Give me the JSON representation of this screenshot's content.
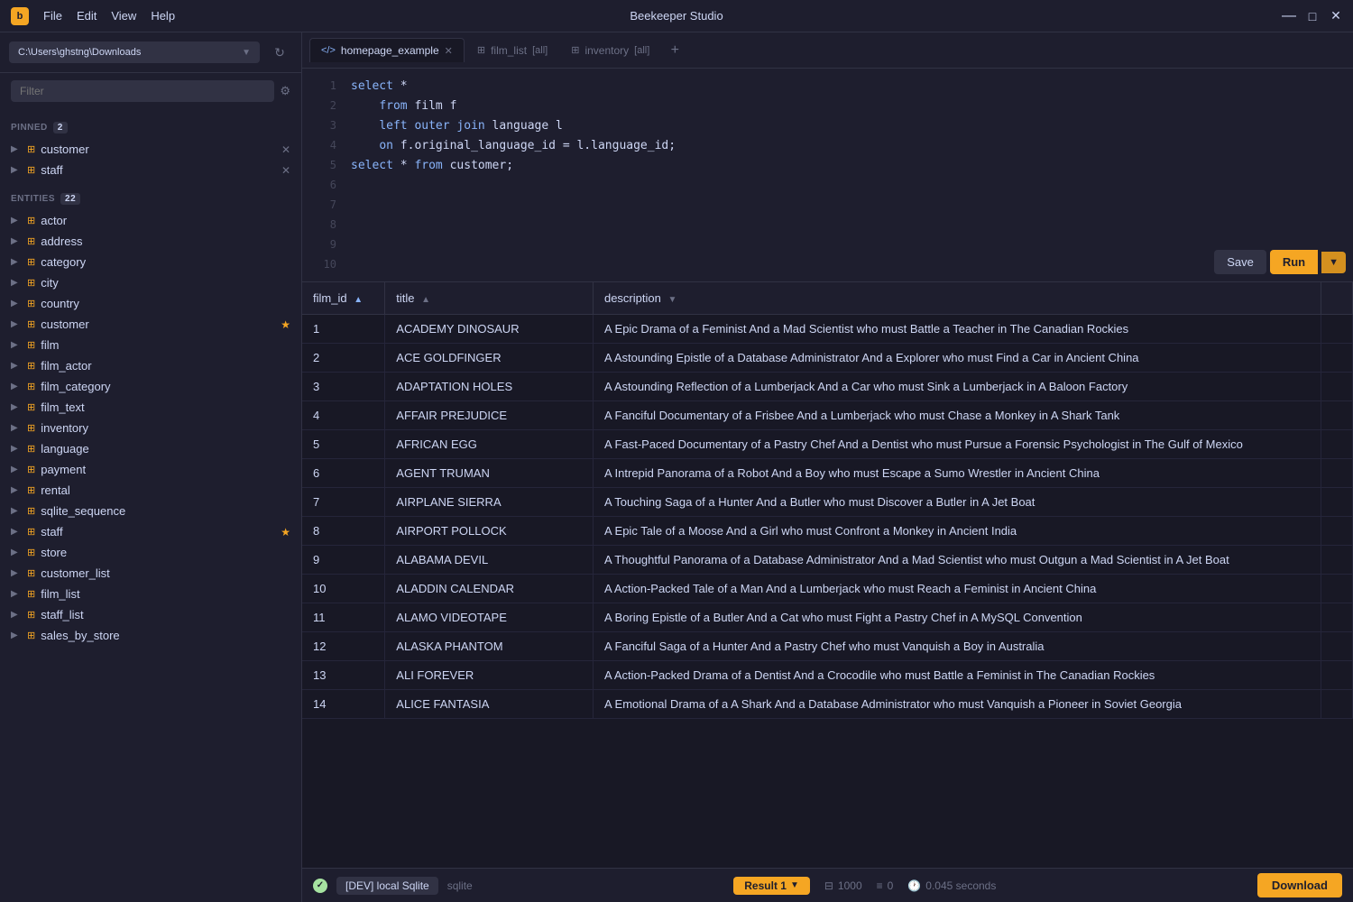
{
  "app": {
    "title": "Beekeeper Studio",
    "window_controls": {
      "minimize": "—",
      "maximize": "□",
      "close": "✕"
    }
  },
  "menu": {
    "items": [
      "File",
      "Edit",
      "View",
      "Help"
    ]
  },
  "sidebar": {
    "connection": "C:\\Users\\ghstng\\Downloads",
    "filter_placeholder": "Filter",
    "pinned": {
      "label": "PINNED",
      "count": 2,
      "items": [
        {
          "name": "customer",
          "pinned": false,
          "has_close": true
        },
        {
          "name": "staff",
          "pinned": false,
          "has_close": true
        }
      ]
    },
    "entities": {
      "label": "ENTITIES",
      "count": 22,
      "items": [
        {
          "name": "actor"
        },
        {
          "name": "address"
        },
        {
          "name": "category"
        },
        {
          "name": "city"
        },
        {
          "name": "country"
        },
        {
          "name": "customer",
          "pinned": true
        },
        {
          "name": "film"
        },
        {
          "name": "film_actor"
        },
        {
          "name": "film_category"
        },
        {
          "name": "film_text"
        },
        {
          "name": "inventory"
        },
        {
          "name": "language"
        },
        {
          "name": "payment"
        },
        {
          "name": "rental"
        },
        {
          "name": "sqlite_sequence"
        },
        {
          "name": "staff",
          "pinned": true
        },
        {
          "name": "store"
        },
        {
          "name": "customer_list"
        },
        {
          "name": "film_list"
        },
        {
          "name": "staff_list"
        },
        {
          "name": "sales_by_store"
        }
      ]
    }
  },
  "tabs": [
    {
      "id": "homepage_example",
      "label": "homepage_example",
      "type": "query",
      "active": true,
      "closeable": true
    },
    {
      "id": "film_list",
      "label": "film_list",
      "suffix": "[all]",
      "type": "table",
      "active": false,
      "closeable": false
    },
    {
      "id": "inventory",
      "label": "inventory",
      "suffix": "[all]",
      "type": "table",
      "active": false,
      "closeable": false
    }
  ],
  "editor": {
    "lines": [
      {
        "num": 1,
        "content": "select *"
      },
      {
        "num": 2,
        "content": "    from film f"
      },
      {
        "num": 3,
        "content": "    left outer join language l"
      },
      {
        "num": 4,
        "content": "    on f.original_language_id = l.language_id;"
      },
      {
        "num": 5,
        "content": "select * from customer;"
      },
      {
        "num": 6,
        "content": ""
      },
      {
        "num": 7,
        "content": ""
      },
      {
        "num": 8,
        "content": ""
      },
      {
        "num": 9,
        "content": ""
      },
      {
        "num": 10,
        "content": ""
      }
    ],
    "save_label": "Save",
    "run_label": "Run"
  },
  "results": {
    "columns": [
      {
        "key": "film_id",
        "label": "film_id",
        "sortable": true,
        "sort": "asc"
      },
      {
        "key": "title",
        "label": "title",
        "sortable": true,
        "sort": null
      },
      {
        "key": "description",
        "label": "description",
        "sortable": true,
        "sort": "desc"
      }
    ],
    "rows": [
      {
        "film_id": 1,
        "title": "ACADEMY DINOSAUR",
        "description": "A Epic Drama of a Feminist And a Mad Scientist who must Battle a Teacher in The Canadian Rockies"
      },
      {
        "film_id": 2,
        "title": "ACE GOLDFINGER",
        "description": "A Astounding Epistle of a Database Administrator And a Explorer who must Find a Car in Ancient China"
      },
      {
        "film_id": 3,
        "title": "ADAPTATION HOLES",
        "description": "A Astounding Reflection of a Lumberjack And a Car who must Sink a Lumberjack in A Baloon Factory"
      },
      {
        "film_id": 4,
        "title": "AFFAIR PREJUDICE",
        "description": "A Fanciful Documentary of a Frisbee And a Lumberjack who must Chase a Monkey in A Shark Tank"
      },
      {
        "film_id": 5,
        "title": "AFRICAN EGG",
        "description": "A Fast-Paced Documentary of a Pastry Chef And a Dentist who must Pursue a Forensic Psychologist in The Gulf of Mexico"
      },
      {
        "film_id": 6,
        "title": "AGENT TRUMAN",
        "description": "A Intrepid Panorama of a Robot And a Boy who must Escape a Sumo Wrestler in Ancient China"
      },
      {
        "film_id": 7,
        "title": "AIRPLANE SIERRA",
        "description": "A Touching Saga of a Hunter And a Butler who must Discover a Butler in A Jet Boat"
      },
      {
        "film_id": 8,
        "title": "AIRPORT POLLOCK",
        "description": "A Epic Tale of a Moose And a Girl who must Confront a Monkey in Ancient India"
      },
      {
        "film_id": 9,
        "title": "ALABAMA DEVIL",
        "description": "A Thoughtful Panorama of a Database Administrator And a Mad Scientist who must Outgun a Mad Scientist in A Jet Boat"
      },
      {
        "film_id": 10,
        "title": "ALADDIN CALENDAR",
        "description": "A Action-Packed Tale of a Man And a Lumberjack who must Reach a Feminist in Ancient China"
      },
      {
        "film_id": 11,
        "title": "ALAMO VIDEOTAPE",
        "description": "A Boring Epistle of a Butler And a Cat who must Fight a Pastry Chef in A MySQL Convention"
      },
      {
        "film_id": 12,
        "title": "ALASKA PHANTOM",
        "description": "A Fanciful Saga of a Hunter And a Pastry Chef who must Vanquish a Boy in Australia"
      },
      {
        "film_id": 13,
        "title": "ALI FOREVER",
        "description": "A Action-Packed Drama of a Dentist And a Crocodile who must Battle a Feminist in The Canadian Rockies"
      },
      {
        "film_id": 14,
        "title": "ALICE FANTASIA",
        "description": "A Emotional Drama of a A Shark And a Database Administrator who must Vanquish a Pioneer in Soviet Georgia"
      }
    ]
  },
  "status_bar": {
    "env_label": "[DEV] local Sqlite",
    "db_type": "sqlite",
    "result_tab": "Result 1",
    "row_count": "1000",
    "null_count": "0",
    "time": "0.045 seconds",
    "download_label": "Download"
  }
}
